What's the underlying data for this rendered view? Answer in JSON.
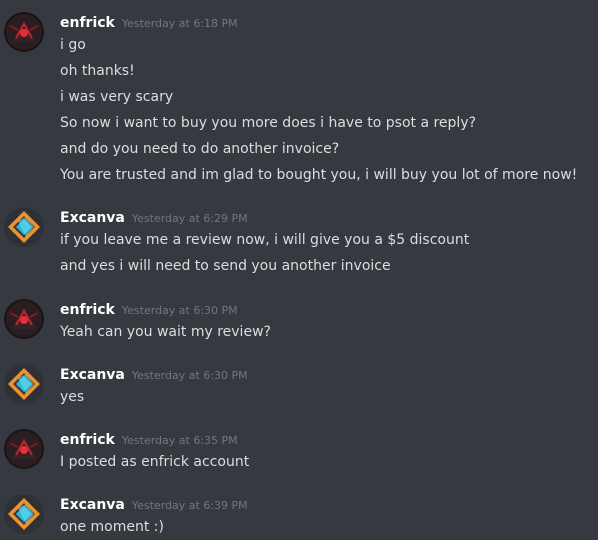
{
  "groups": [
    {
      "author": "enfrick",
      "avatar_icon": "red-dark-avatar-icon",
      "timestamp": "Yesterday at 6:18 PM",
      "lines": [
        "i go",
        "oh thanks!",
        "i was very scary",
        "So now i want to buy you more does i have to psot a reply?",
        "and do you need to do another invoice?",
        "You are trusted and im glad to bought you, i will buy you lot of more now!"
      ]
    },
    {
      "author": "Excanva",
      "avatar_icon": "diamond-logo-avatar-icon",
      "timestamp": "Yesterday at 6:29 PM",
      "lines": [
        "if you leave me a review now, i will give you a $5 discount",
        "and yes i will need to send you another invoice"
      ]
    },
    {
      "author": "enfrick",
      "avatar_icon": "red-dark-avatar-icon",
      "timestamp": "Yesterday at 6:30 PM",
      "lines": [
        "Yeah can you wait my review?"
      ]
    },
    {
      "author": "Excanva",
      "avatar_icon": "diamond-logo-avatar-icon",
      "timestamp": "Yesterday at 6:30 PM",
      "lines": [
        "yes"
      ]
    },
    {
      "author": "enfrick",
      "avatar_icon": "red-dark-avatar-icon",
      "timestamp": "Yesterday at 6:35 PM",
      "lines": [
        "I posted as enfrick account"
      ]
    },
    {
      "author": "Excanva",
      "avatar_icon": "diamond-logo-avatar-icon",
      "timestamp": "Yesterday at 6:39 PM",
      "lines": [
        "one moment :)"
      ]
    }
  ],
  "colors": {
    "background": "#36393f",
    "username": "#ffffff",
    "timestamp": "#72767d",
    "message_text": "#dcddde"
  }
}
